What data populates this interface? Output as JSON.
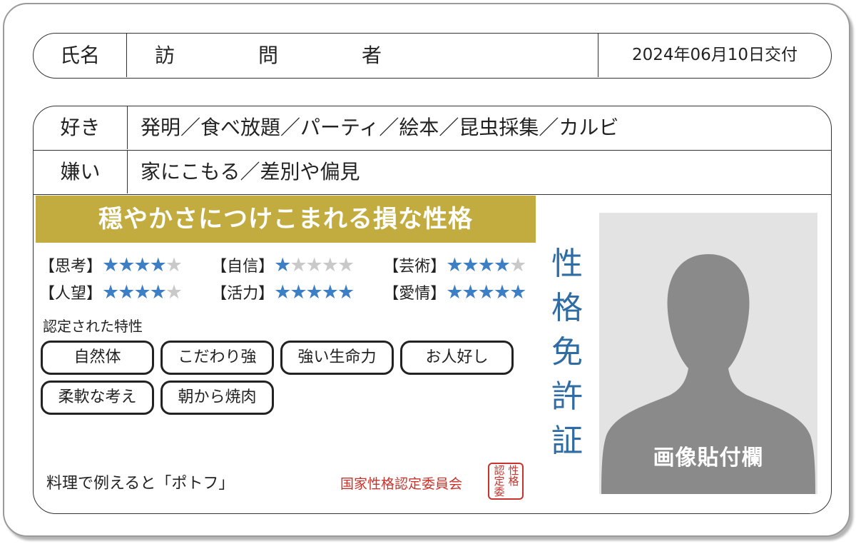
{
  "name": {
    "label": "氏名",
    "chars": [
      "訪",
      "問",
      "者"
    ],
    "issued": "2024年06月10日交付"
  },
  "likes": {
    "label": "好き",
    "value": "発明／食べ放題／パーティ／絵本／昆虫採集／カルビ"
  },
  "dislikes": {
    "label": "嫌い",
    "value": "家にこもる／差別や偏見"
  },
  "banner": "穏やかさにつけこまれる損な性格",
  "stats": [
    {
      "name": "【思考】",
      "rating": 4
    },
    {
      "name": "【自信】",
      "rating": 1
    },
    {
      "name": "【芸術】",
      "rating": 4
    },
    {
      "name": "【人望】",
      "rating": 4
    },
    {
      "name": "【活力】",
      "rating": 5
    },
    {
      "name": "【愛情】",
      "rating": 5
    }
  ],
  "traits_title": "認定された特性",
  "traits": [
    "自然体",
    "こだわり強",
    "強い生命力",
    "お人好し",
    "柔軟な考え",
    "朝から焼肉"
  ],
  "food_comparison": "料理で例えると「ポトフ」",
  "committee": "国家性格認定委員会",
  "seal_columns": [
    "性格",
    "認定委"
  ],
  "vertical_title": [
    "性",
    "格",
    "免",
    "許",
    "証"
  ],
  "photo_caption": "画像貼付欄",
  "colors": {
    "banner": "#c3ac3f",
    "star_on": "#3d7fc4",
    "star_off": "#c9c9c9",
    "title_blue": "#2f6ca4",
    "seal_red": "#c8332c"
  }
}
